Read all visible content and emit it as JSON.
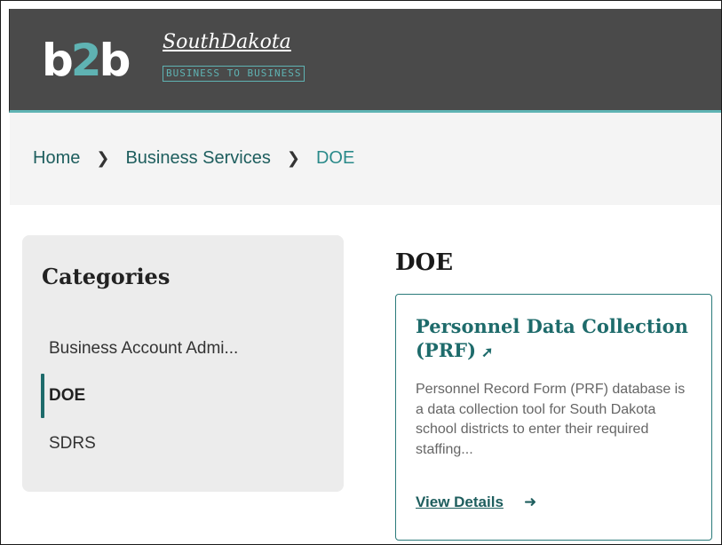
{
  "header": {
    "logo_b2b": [
      "b",
      "2",
      "b"
    ],
    "logo_script": "SouthDakota",
    "logo_tagline": "BUSINESS TO BUSINESS"
  },
  "breadcrumb": {
    "items": [
      "Home",
      "Business Services"
    ],
    "current": "DOE"
  },
  "sidebar": {
    "title": "Categories",
    "items": [
      {
        "label": "Business Account Admi..."
      },
      {
        "label": "DOE",
        "active": true
      },
      {
        "label": "SDRS"
      }
    ]
  },
  "main": {
    "title": "DOE",
    "cards": [
      {
        "title_line1": "Personnel Data Collection",
        "title_line2": "(PRF)",
        "external_icon": "external-link-icon",
        "description": "Personnel Record Form (PRF) database is a data collection tool for South Dakota school districts to enter their required staffing...",
        "link": "View Details",
        "link_icon": "arrow-right-icon"
      }
    ]
  },
  "colors": {
    "header_bg": "#4a4a4a",
    "accent": "#5fb3b3",
    "link": "#1e5e5e",
    "sidebar_bg": "#ececec",
    "breadcrumb_bg": "#f4f4f4"
  }
}
